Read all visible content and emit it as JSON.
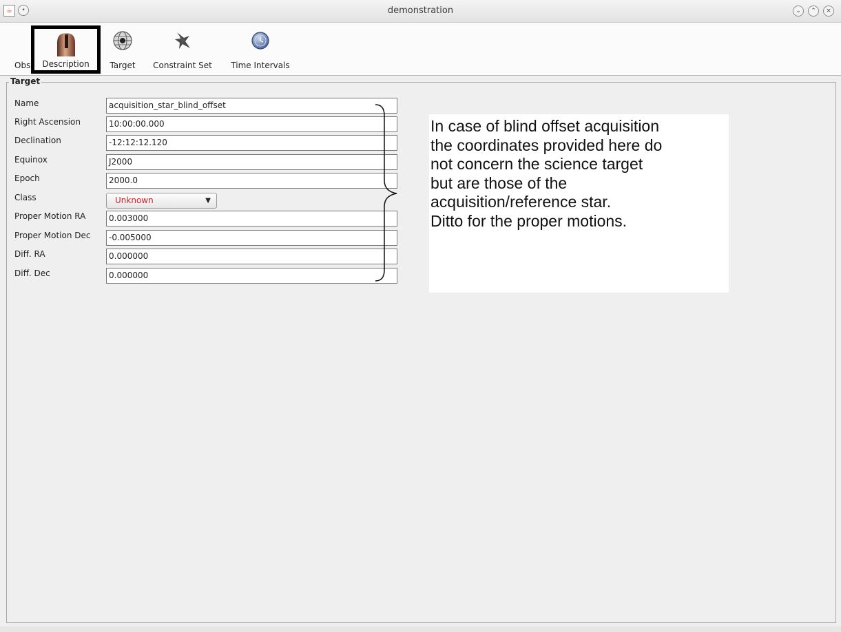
{
  "window": {
    "title": "demonstration",
    "app_icon": "java-icon",
    "controls": [
      "minimize-icon",
      "maximize-icon",
      "close-icon"
    ]
  },
  "toolbar": {
    "items": [
      {
        "label": "Obs",
        "icon": "telescope-icon"
      },
      {
        "label": "Description",
        "icon": "telescope-dome-icon",
        "highlighted": true
      },
      {
        "label": "Target",
        "icon": "globe-icon"
      },
      {
        "label": "Constraint Set",
        "icon": "constraint-icon"
      },
      {
        "label": "Time Intervals",
        "icon": "clock-icon"
      }
    ]
  },
  "target_panel": {
    "title": "Target",
    "fields": [
      {
        "label": "Name",
        "value": "acquisition_star_blind_offset"
      },
      {
        "label": "Right Ascension",
        "value": " 10:00:00.000"
      },
      {
        "label": "Declination",
        "value": "-12:12:12.120"
      },
      {
        "label": "Equinox",
        "value": "J2000"
      },
      {
        "label": "Epoch",
        "value": "2000.0"
      },
      {
        "label": "Class",
        "value": "Unknown"
      },
      {
        "label": "Proper Motion RA",
        "value": "0.003000"
      },
      {
        "label": "Proper Motion Dec",
        "value": "-0.005000"
      },
      {
        "label": "Diff. RA",
        "value": "0.000000"
      },
      {
        "label": "Diff. Dec",
        "value": "0.000000"
      }
    ]
  },
  "annotation": {
    "lines": [
      "In case of blind offset acquisition",
      "the coordinates provided here do",
      "not concern the science target",
      "but are those of the",
      "acquisition/reference star.",
      "Ditto for the proper motions."
    ]
  },
  "colors": {
    "class_value": "#c0282d",
    "highlight_border": "#000000"
  }
}
